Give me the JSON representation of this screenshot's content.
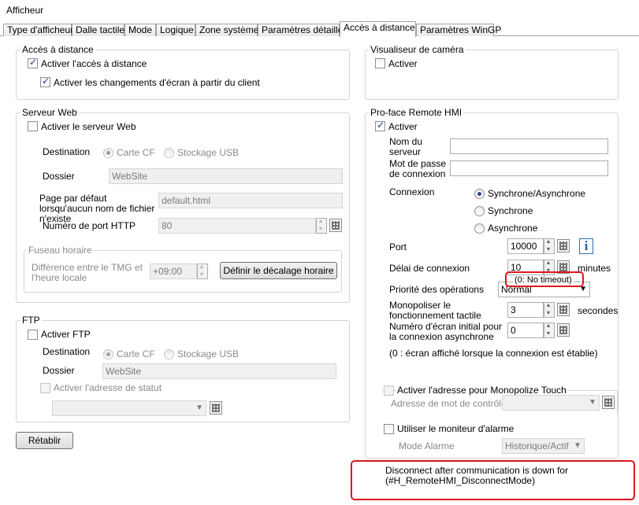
{
  "window": {
    "title": "Afficheur"
  },
  "tabs": [
    {
      "label": "Type d'afficheur"
    },
    {
      "label": "Dalle tactile"
    },
    {
      "label": "Mode"
    },
    {
      "label": "Logique"
    },
    {
      "label": "Zone système"
    },
    {
      "label": "Paramètres détaillés"
    },
    {
      "label": "Accès à distance"
    },
    {
      "label": "Paramètres WinGP"
    }
  ],
  "remote_access": {
    "legend": "Accès à distance",
    "enable_label": "Activer l'accès à distance",
    "screen_change_label": "Activer les changements d'écran à partir du client"
  },
  "camera": {
    "legend": "Visualiseur de caméra",
    "enable_label": "Activer"
  },
  "web_server": {
    "legend": "Serveur Web",
    "enable_label": "Activer le serveur Web",
    "destination_label": "Destination",
    "carte_cf": "Carte CF",
    "usb": "Stockage USB",
    "folder_label": "Dossier",
    "folder_value": "WebSite",
    "default_page_label": "Page par défaut lorsqu'aucun nom de fichier n'existe",
    "default_page_value": "default.html",
    "port_label": "Numéro de port HTTP",
    "port_value": "80",
    "tz_legend": "Fuseau horaire",
    "tz_label": "Différence entre le TMG et l'heure locale",
    "tz_value": "+09:00",
    "tz_button": "Définir le décalage horaire"
  },
  "ftp": {
    "legend": "FTP",
    "enable_label": "Activer FTP",
    "destination_label": "Destination",
    "carte_cf": "Carte CF",
    "usb": "Stockage USB",
    "folder_label": "Dossier",
    "folder_value": "WebSite",
    "status_label": "Activer l'adresse de statut"
  },
  "reset_button": "Rétablir",
  "remote_hmi": {
    "legend": "Pro-face Remote HMI",
    "enable_label": "Activer",
    "server_name_label": "Nom du serveur",
    "password_label": "Mot de passe de connexion",
    "connection_label": "Connexion",
    "sync_async": "Synchrone/Asynchrone",
    "sync": "Synchrone",
    "async": "Asynchrone",
    "port_label": "Port",
    "port_value": "10000",
    "timeout_label": "Délai de connexion",
    "timeout_value": "10",
    "timeout_unit": "minutes",
    "timeout_note": "(0: No timeout)",
    "priority_label": "Priorité des opérations",
    "priority_value": "Normal",
    "monopolize_label": "Monopoliser le fonctionnement tactile",
    "monopolize_value": "3",
    "monopolize_unit": "secondes",
    "initial_screen_label": "Numéro d'écran initial pour la connexion asynchrone",
    "initial_screen_value": "0",
    "initial_screen_note": "(0 : écran affiché lorsque la connexion est établie)",
    "monopolize_touch_label": "Activer l'adresse pour Monopolize Touch",
    "control_word_label": "Adresse de mot de contrôle",
    "alarm_monitor_label": "Utiliser le moniteur d'alarme",
    "alarm_mode_label": "Mode Alarme",
    "alarm_mode_value": "Historique/Actif",
    "disconnect_line1": "Disconnect after communication is down for",
    "disconnect_line2": "(#H_RemoteHMI_DisconnectMode)"
  },
  "colors": {
    "highlight": "#e0161d",
    "info": "#1c66b5"
  }
}
